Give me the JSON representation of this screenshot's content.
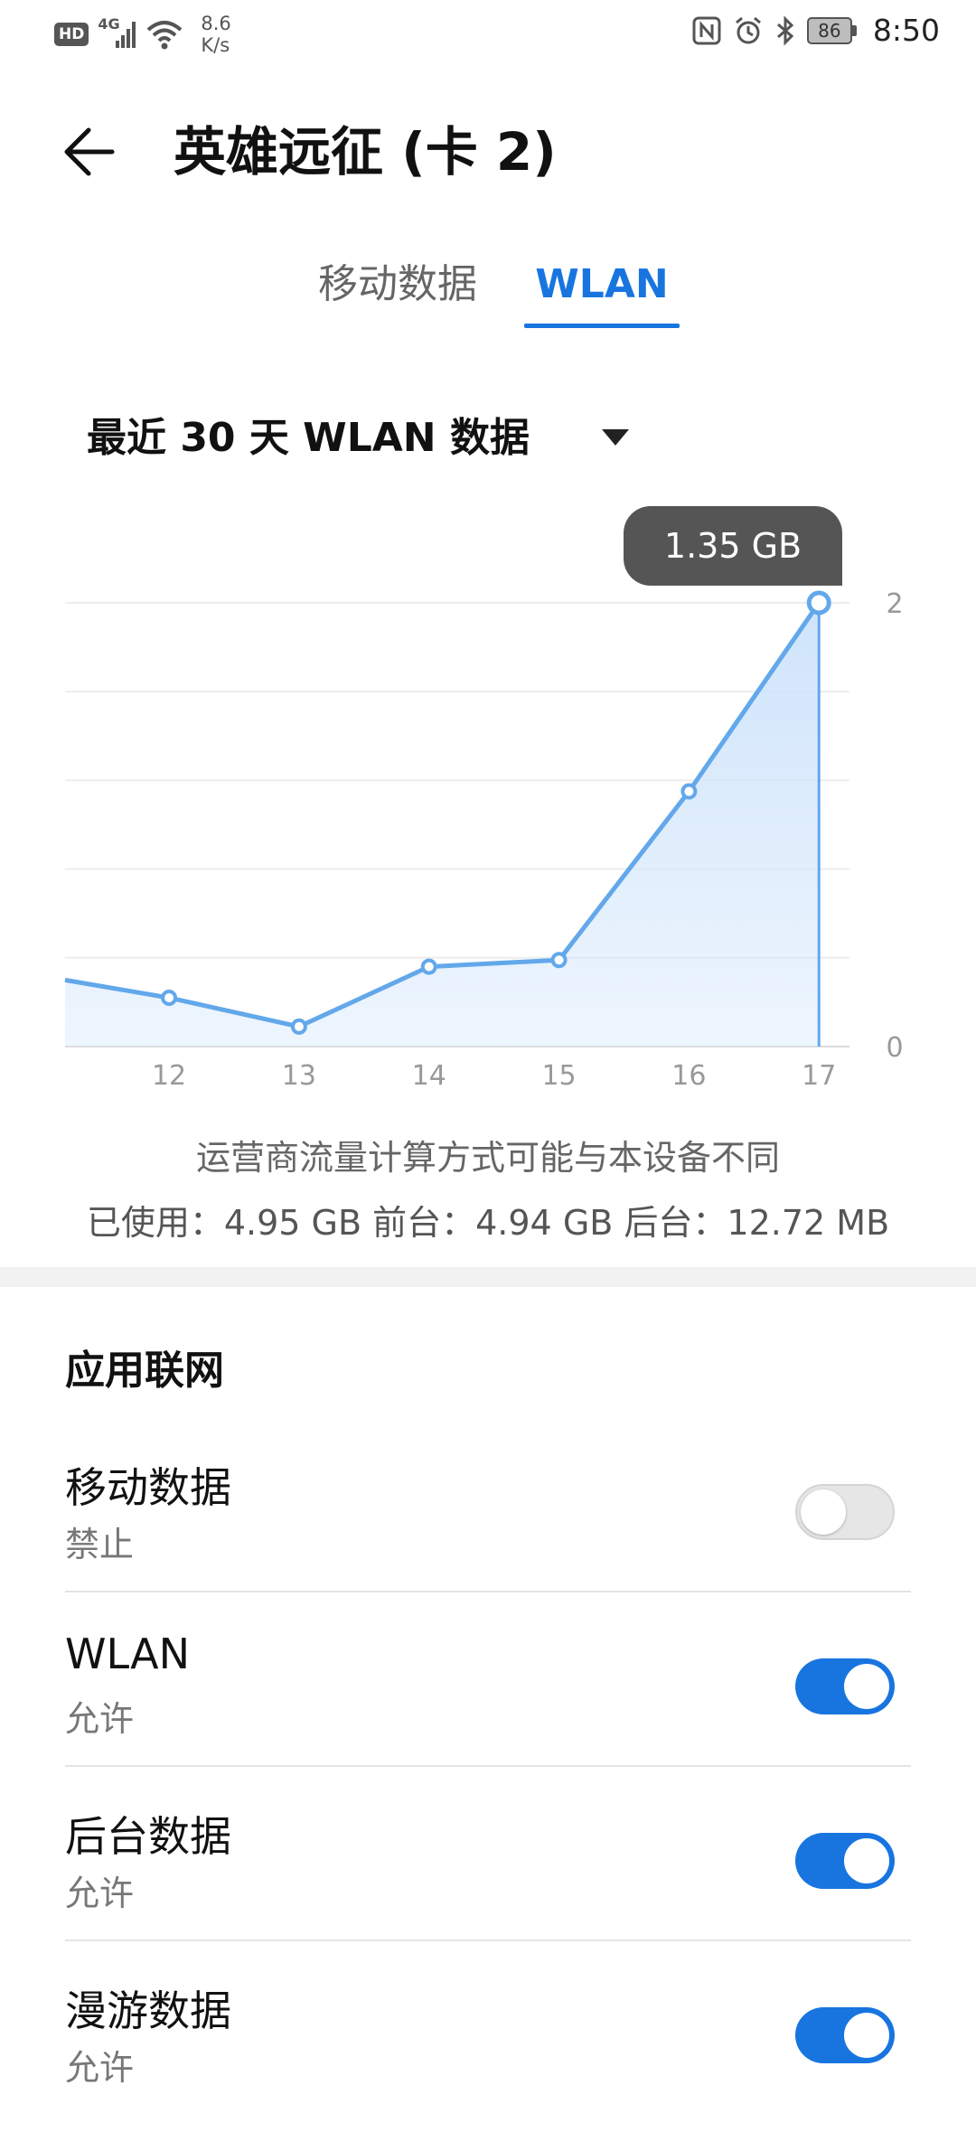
{
  "status_bar": {
    "hd": "HD",
    "network_type": "4G",
    "speed_value": "8.6",
    "speed_unit": "K/s",
    "battery": "86",
    "time": "8:50"
  },
  "header": {
    "title": "英雄远征 (卡 2)"
  },
  "tabs": [
    {
      "label": "移动数据",
      "active": false
    },
    {
      "label": "WLAN",
      "active": true
    }
  ],
  "range_selector": {
    "label": "最近 30 天 WLAN 数据"
  },
  "chart_data": {
    "type": "area",
    "x": [
      11.2,
      12,
      13,
      14,
      15,
      16,
      17
    ],
    "x_tick_labels": [
      "12",
      "13",
      "14",
      "15",
      "16",
      "17"
    ],
    "x_tick_values": [
      12,
      13,
      14,
      15,
      16,
      17
    ],
    "y": [
      0.3,
      0.22,
      0.09,
      0.36,
      0.39,
      1.15,
      2.0
    ],
    "ylim": [
      0,
      2
    ],
    "y_tick_labels": [
      "0",
      "2"
    ],
    "selected_label": "1.35 GB",
    "colors": {
      "line": "#62a8ea",
      "fill": "#cfe4fb"
    }
  },
  "notes": {
    "carrier_note": "运营商流量计算方式可能与本设备不同",
    "usage": "已使用：4.95 GB 前台：4.94 GB 后台：12.72 MB"
  },
  "app_network": {
    "section_title": "应用联网",
    "rows": [
      {
        "title": "移动数据",
        "subtitle": "禁止",
        "enabled": false
      },
      {
        "title": "WLAN",
        "subtitle": "允许",
        "enabled": true
      },
      {
        "title": "后台数据",
        "subtitle": "允许",
        "enabled": true
      },
      {
        "title": "漫游数据",
        "subtitle": "允许",
        "enabled": true
      }
    ]
  },
  "colors": {
    "accent": "#1875e0",
    "toggle_off": "#e6e6e6"
  }
}
